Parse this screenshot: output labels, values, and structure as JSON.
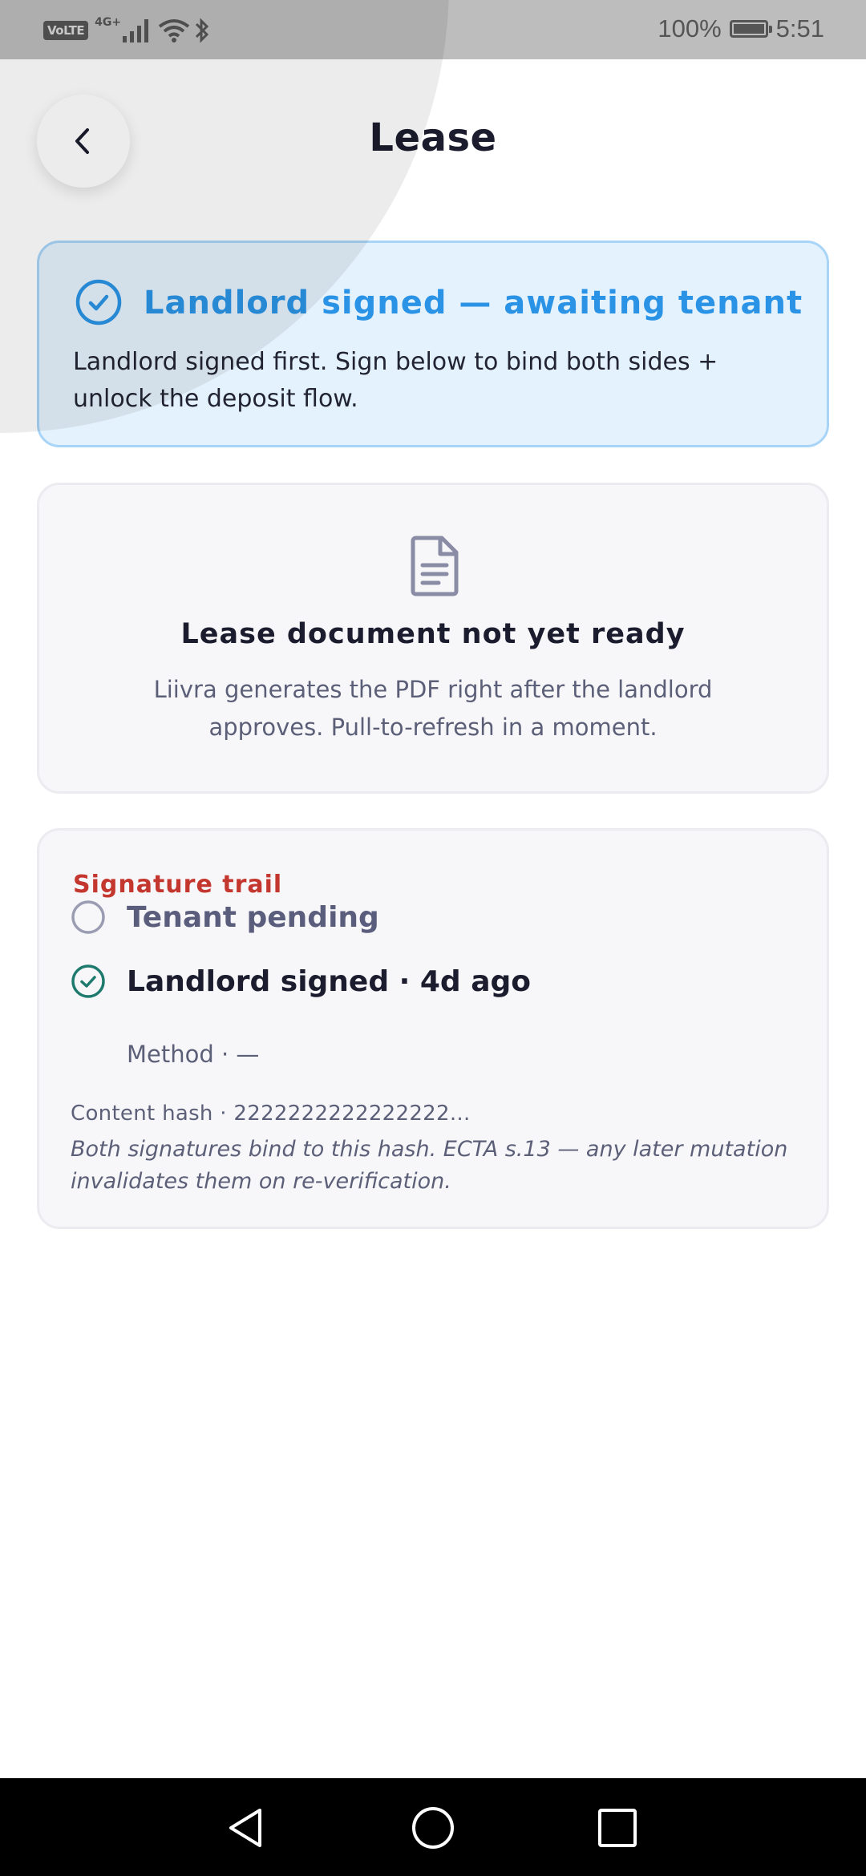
{
  "status_bar": {
    "volte": "VoLTE",
    "network": "4G+",
    "battery_percent": "100%",
    "time": "5:51"
  },
  "header": {
    "title": "Lease"
  },
  "banner": {
    "title": "Landlord signed — awaiting tenant",
    "body": "Landlord signed first. Sign below to bind both sides + unlock the deposit flow.",
    "accent_color": "#2b93e6"
  },
  "document_card": {
    "title": "Lease document not yet ready",
    "body": "Liivra generates the PDF right after the landlord approves. Pull-to-refresh in a moment."
  },
  "signature_trail": {
    "heading": "Signature trail",
    "heading_color": "#c4372e",
    "rows": [
      {
        "label": "Tenant pending",
        "icon": "empty-circle-icon"
      },
      {
        "label": "Landlord signed · 4d ago",
        "icon": "check-circle-icon"
      }
    ],
    "method": "Method · —",
    "content_hash": "Content hash · 2222222222222222...",
    "hash_note": "Both signatures bind to this hash. ECTA s.13 — any later mutation invalidates them on re-verification."
  }
}
